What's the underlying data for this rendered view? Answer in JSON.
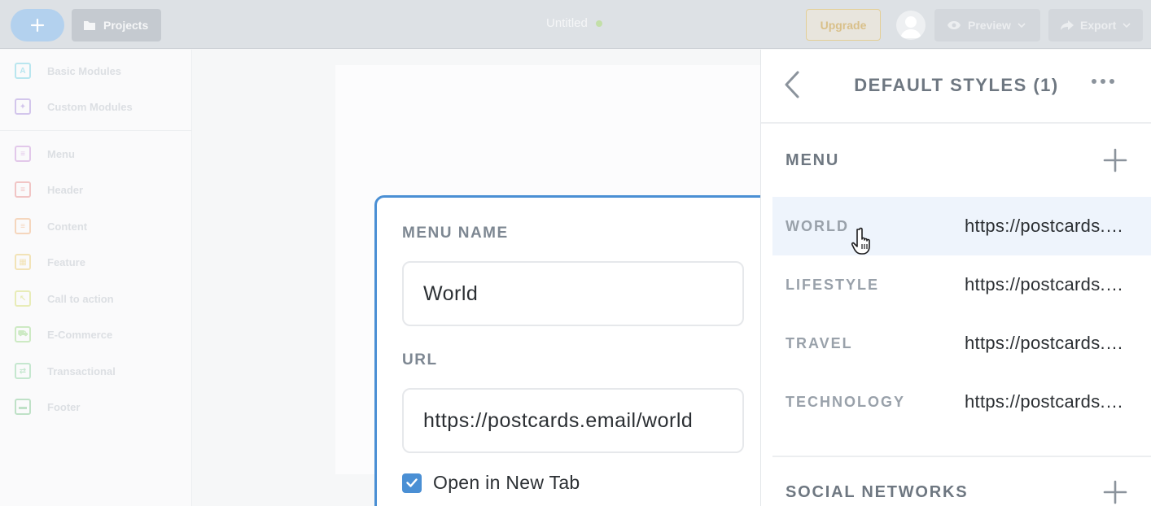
{
  "topbar": {
    "projects_label": "Projects",
    "doc_title": "Untitled",
    "upgrade_label": "Upgrade",
    "preview_label": "Preview",
    "export_label": "Export"
  },
  "sidebar": {
    "items": [
      {
        "label": "Basic Modules",
        "icon": "text-icon",
        "color": "#b9e6ef"
      },
      {
        "label": "Custom Modules",
        "icon": "puzzle-icon",
        "color": "#d3c6ec"
      },
      {
        "label": "Menu",
        "icon": "menu-module-icon",
        "color": "#e2c8ea"
      },
      {
        "label": "Header",
        "icon": "header-module-icon",
        "color": "#f1c5c5"
      },
      {
        "label": "Content",
        "icon": "content-module-icon",
        "color": "#f5d6bd"
      },
      {
        "label": "Feature",
        "icon": "feature-module-icon",
        "color": "#f2e3b7"
      },
      {
        "label": "Call to action",
        "icon": "cta-module-icon",
        "color": "#e8ecb8"
      },
      {
        "label": "E-Commerce",
        "icon": "cart-icon",
        "color": "#cdeac4"
      },
      {
        "label": "Transactional",
        "icon": "transactional-icon",
        "color": "#c5e7cf"
      },
      {
        "label": "Footer",
        "icon": "footer-module-icon",
        "color": "#bfe1c7"
      }
    ]
  },
  "editor": {
    "menu_name_label": "MENU NAME",
    "menu_name_value": "World",
    "url_label": "URL",
    "url_value": "https://postcards.email/world",
    "new_tab_label": "Open in New Tab",
    "new_tab_checked": true
  },
  "panel": {
    "title": "DEFAULT STYLES (1)",
    "menu_section_title": "MENU",
    "menu_items": [
      {
        "name": "WORLD",
        "url": "https://postcards.email/world"
      },
      {
        "name": "LIFESTYLE",
        "url": "https://postcards.email/lifestyle"
      },
      {
        "name": "TRAVEL",
        "url": "https://postcards.email/travel"
      },
      {
        "name": "TECHNOLOGY",
        "url": "https://postcards.email/technology"
      }
    ],
    "social_section_title": "SOCIAL NETWORKS"
  },
  "colors": {
    "accent": "#4a8fd4",
    "active_row": "#eef4fc"
  }
}
